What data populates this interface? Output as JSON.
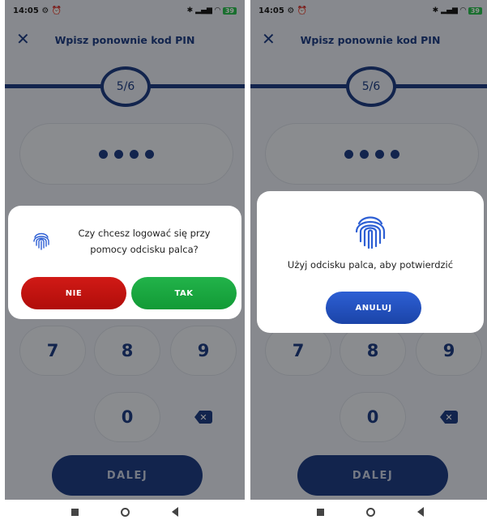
{
  "status": {
    "time": "14:05",
    "battery": "39"
  },
  "header": {
    "title": "Wpisz ponownie kod PIN"
  },
  "progress": {
    "step": "5/6"
  },
  "keypad": {
    "keys": [
      "7",
      "8",
      "9",
      "0"
    ],
    "confirm_label": "DALEJ"
  },
  "dialog_left": {
    "message": "Czy chcesz logować się przy pomocy odcisku palca?",
    "no_label": "NIE",
    "yes_label": "TAK"
  },
  "dialog_right": {
    "message": "Użyj odcisku palca, aby potwierdzić",
    "cancel_label": "ANULUJ"
  },
  "colors": {
    "primary": "#1f3f86",
    "danger": "#c4120f",
    "success": "#1ca83f",
    "accent": "#2d5fd4"
  },
  "icons": [
    "close-icon",
    "fingerprint-icon",
    "backspace-icon",
    "alarm-icon",
    "gear-icon",
    "wifi-icon",
    "signal-icon",
    "battery-icon"
  ]
}
